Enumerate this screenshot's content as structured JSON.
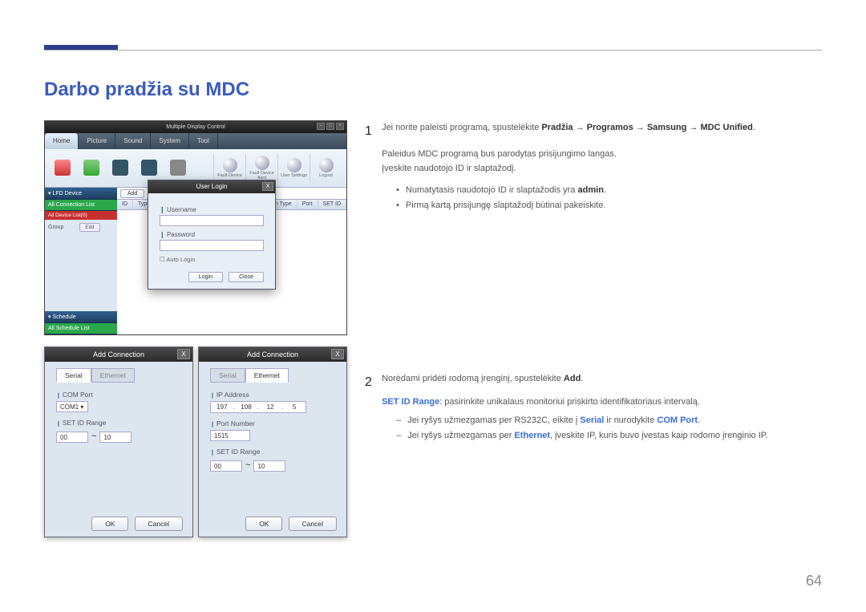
{
  "page": {
    "title": "Darbo pradžia su MDC",
    "number": "64"
  },
  "app": {
    "window_title": "Multiple Display Control",
    "menu": [
      "Home",
      "Picture",
      "Sound",
      "System",
      "Tool"
    ],
    "toolbar_right": [
      "Fault Device",
      "Fault Device Alert",
      "User Settings",
      "Logout"
    ],
    "sidebar": {
      "lfd": "▾ LFD Device",
      "conn_list": "All Connection List",
      "limit": "All Device List(0)",
      "group": "Group",
      "edit": "Edit",
      "schedule": "▾ Schedule",
      "sched_list": "All Schedule List"
    },
    "tbltop": {
      "add": "Add"
    },
    "tblhdr": [
      "ID",
      "Type",
      "Connection Type",
      "Port",
      "SET ID"
    ]
  },
  "login": {
    "title": "User Login",
    "username": "Username",
    "password": "Password",
    "auto": "Auto Login",
    "login_btn": "Login",
    "close_btn": "Close"
  },
  "dlg": {
    "title": "Add Connection",
    "tab_serial": "Serial",
    "tab_eth": "Ethernet",
    "com_port_l": "COM Port",
    "com_port_v": "COM1",
    "setid_l": "SET ID Range",
    "rng_from": "00",
    "rng_to": "10",
    "ip_l": "IP Address",
    "ip_v": [
      "197",
      "108",
      "12",
      "5"
    ],
    "port_l": "Port Number",
    "port_v": "1515",
    "ok": "OK",
    "cancel": "Cancel"
  },
  "step1": {
    "num": "1",
    "text_pre": "Jei norite paleisti programą, spustelėkite ",
    "path": "Pradžia → Programos → Samsung → MDC Unified",
    "p1": "Paleidus MDC programą bus parodytas prisijungimo langas.",
    "p2": "Įveskite naudotojo ID ir slaptažodį.",
    "b1_pre": "Numatytasis naudotojo ID ir slaptažodis yra ",
    "b1_bold": "admin",
    "b1_post": ".",
    "b2": "Pirmą kartą prisijungę slaptažodį būtinai pakeiskite."
  },
  "step2": {
    "num": "2",
    "text_pre": "Norėdami pridėti rodomą įrenginį, spustelėkite ",
    "text_bold": "Add",
    "text_post": ".",
    "l1_blue": "SET ID Range",
    "l1_rest": ": pasirinkite unikalaus monitoriui priskirto identifikatoriaus intervalą.",
    "d1_pre": "Jei ryšys užmezgamas per RS232C, eikite į ",
    "d1_blue1": "Serial",
    "d1_mid": " ir nurodykite ",
    "d1_blue2": "COM Port",
    "d1_post": ".",
    "d2_pre": "Jei ryšys užmezgamas per ",
    "d2_blue": "Ethernet",
    "d2_post": ", įveskite IP, kuris buvo įvestas kaip rodomo įrenginio IP."
  }
}
